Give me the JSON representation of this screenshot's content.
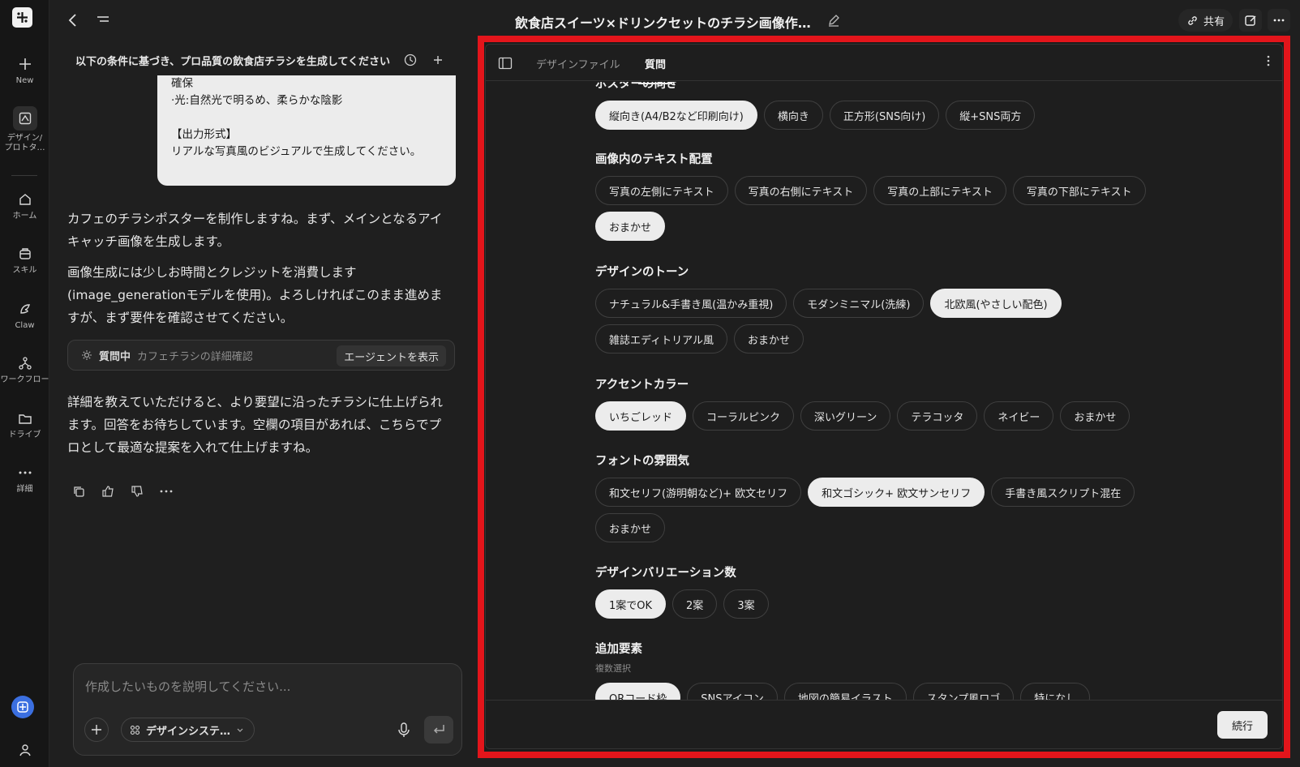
{
  "rail": {
    "new": "New",
    "design": "デザイン/\nプロトタ…",
    "home": "ホーム",
    "skill": "スキル",
    "claw": "Claw",
    "workflow": "ワークフロー",
    "drive": "ドライブ",
    "more": "詳細"
  },
  "topbar": {
    "title": "飲食店スイーツ×ドリンクセットのチラシ画像作…",
    "share": "共有"
  },
  "chat": {
    "header": "以下の条件に基づき、プロ品質の飲食店チラシを生成してください",
    "bubble": {
      "l1": "確保",
      "l2": "·光:自然光で明るめ、柔らかな陰影",
      "l3": "【出力形式】",
      "l4": "リアルな写真風のビジュアルで生成してください。"
    },
    "msg1": "カフェのチラシポスターを制作しますね。まず、メインとなるアイキャッチ画像を生成します。",
    "msg2": "画像生成には少しお時間とクレジットを消費します(image_generationモデルを使用)。よろしければこのまま進めますが、まず要件を確認させてください。",
    "status_label": "質問中",
    "status_detail": "カフェチラシの詳細確認",
    "agent_btn": "エージェントを表示",
    "msg3": "詳細を教えていただけると、より要望に沿ったチラシに仕上げられます。回答をお待ちしています。空欄の項目があれば、こちらでプロとして最適な提案を入れて仕上げますね。"
  },
  "composer": {
    "placeholder": "作成したいものを説明してください...",
    "design_system": "デザインシステ…"
  },
  "panel": {
    "tab_design": "デザインファイル",
    "tab_question": "質問",
    "continue": "続行",
    "sections": {
      "orientation": {
        "title": "ポスターの向き",
        "options": [
          "縦向き(A4/B2など印刷向け)",
          "横向き",
          "正方形(SNS向け)",
          "縦+SNS両方"
        ]
      },
      "text_layout": {
        "title": "画像内のテキスト配置",
        "options": [
          "写真の左側にテキスト",
          "写真の右側にテキスト",
          "写真の上部にテキスト",
          "写真の下部にテキスト",
          "おまかせ"
        ]
      },
      "tone": {
        "title": "デザインのトーン",
        "options": [
          "ナチュラル&手書き風(温かみ重視)",
          "モダンミニマル(洗練)",
          "北欧風(やさしい配色)",
          "雑誌エディトリアル風",
          "おまかせ"
        ]
      },
      "accent": {
        "title": "アクセントカラー",
        "options": [
          "いちごレッド",
          "コーラルピンク",
          "深いグリーン",
          "テラコッタ",
          "ネイビー",
          "おまかせ"
        ]
      },
      "font": {
        "title": "フォントの雰囲気",
        "options": [
          "和文セリフ(游明朝など)+ 欧文セリフ",
          "和文ゴシック+ 欧文サンセリフ",
          "手書き風スクリプト混在",
          "おまかせ"
        ]
      },
      "variations": {
        "title": "デザインバリエーション数",
        "options": [
          "1案でOK",
          "2案",
          "3案"
        ]
      },
      "extras": {
        "title": "追加要素",
        "subtitle": "複数選択",
        "options": [
          "QRコード枠",
          "SNSアイコン",
          "地図の簡易イラスト",
          "スタンプ風ロゴ",
          "特になし"
        ]
      }
    }
  },
  "colors": {
    "frame": "#e3151b",
    "chip_selected": "#ececec",
    "background": "#1f1f1f"
  }
}
